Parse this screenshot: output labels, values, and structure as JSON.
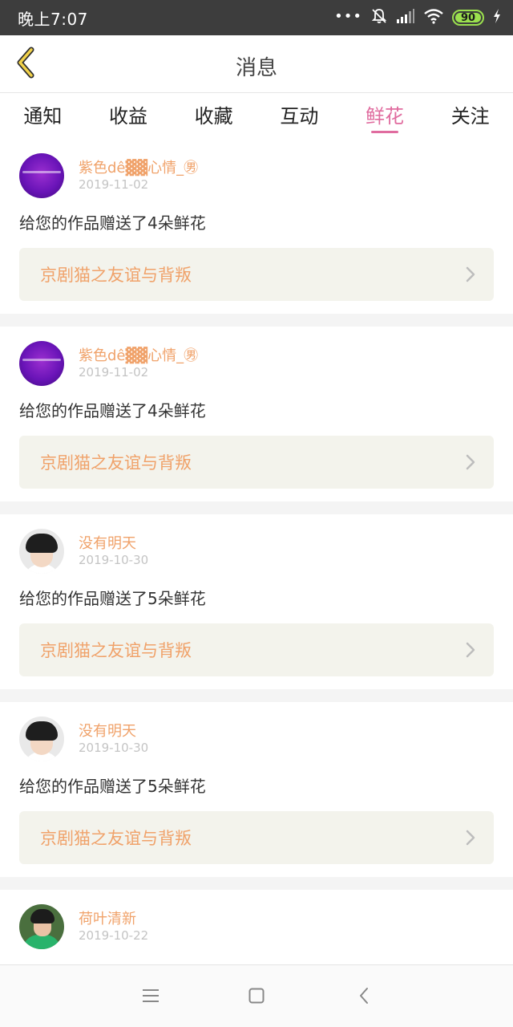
{
  "status_bar": {
    "time": "晚上7:07",
    "dots": "•••",
    "battery": "90",
    "icons": [
      "bell-off-icon",
      "signal-icon",
      "wifi-icon",
      "battery-icon",
      "charging-icon"
    ]
  },
  "header": {
    "title": "消息",
    "back_icon": "chevron-left-icon"
  },
  "tabs": [
    {
      "label": "通知",
      "active": false
    },
    {
      "label": "收益",
      "active": false
    },
    {
      "label": "收藏",
      "active": false
    },
    {
      "label": "互动",
      "active": false
    },
    {
      "label": "鲜花",
      "active": true
    },
    {
      "label": "关注",
      "active": false
    }
  ],
  "messages": [
    {
      "user": "紫色dê▓▓心情_㊚",
      "date": "2019-11-02",
      "text": "给您的作品赠送了4朵鲜花",
      "work": "京剧猫之友谊与背叛"
    },
    {
      "user": "紫色dê▓▓心情_㊚",
      "date": "2019-11-02",
      "text": "给您的作品赠送了4朵鲜花",
      "work": "京剧猫之友谊与背叛"
    },
    {
      "user": "没有明天",
      "date": "2019-10-30",
      "text": "给您的作品赠送了5朵鲜花",
      "work": "京剧猫之友谊与背叛"
    },
    {
      "user": "没有明天",
      "date": "2019-10-30",
      "text": "给您的作品赠送了5朵鲜花",
      "work": "京剧猫之友谊与背叛"
    },
    {
      "user": "荷叶清新",
      "date": "2019-10-22"
    }
  ],
  "colors": {
    "accent": "#e06c9f",
    "name": "#f0a26a",
    "status_bar": "#3d3d3d",
    "card_bg": "#f3f3ec"
  },
  "nav": {
    "icons": [
      "menu-icon",
      "home-square-icon",
      "back-triangle-icon"
    ]
  }
}
